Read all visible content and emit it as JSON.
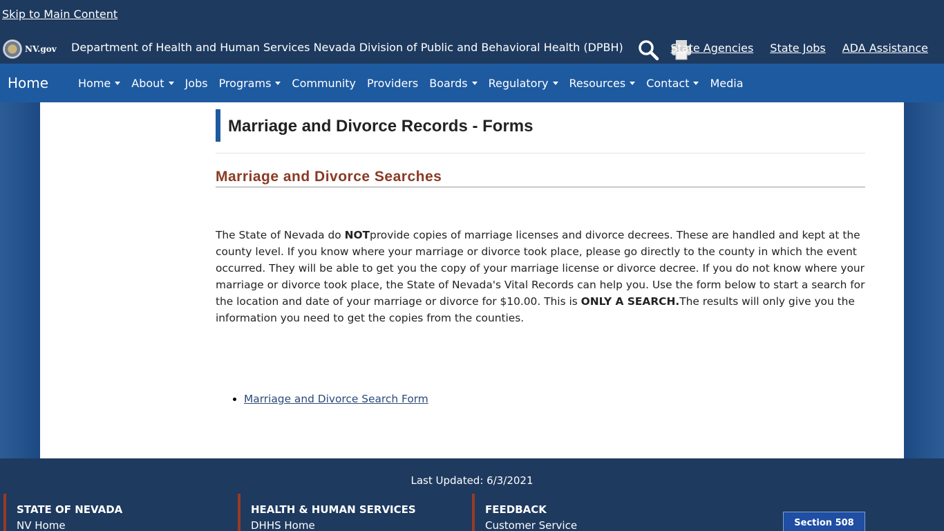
{
  "header": {
    "skip_link": "Skip to Main Content",
    "logo_text": "NV.gov",
    "agency_title": "Department of Health and Human Services Nevada Division of Public and Behavioral Health (DPBH)",
    "icons": [
      "search-icon",
      "print-icon"
    ],
    "util_links": [
      "State Agencies",
      "State Jobs",
      "ADA Assistance"
    ]
  },
  "nav": {
    "brand": "Home",
    "items": [
      {
        "label": "Home",
        "dropdown": true
      },
      {
        "label": "About",
        "dropdown": true
      },
      {
        "label": "Jobs",
        "dropdown": false
      },
      {
        "label": "Programs",
        "dropdown": true
      },
      {
        "label": "Community",
        "dropdown": false
      },
      {
        "label": "Providers",
        "dropdown": false
      },
      {
        "label": "Boards",
        "dropdown": true
      },
      {
        "label": "Regulatory",
        "dropdown": true
      },
      {
        "label": "Resources",
        "dropdown": true
      },
      {
        "label": "Contact",
        "dropdown": true
      },
      {
        "label": "Media",
        "dropdown": false
      }
    ]
  },
  "main": {
    "page_title": "Marriage and Divorce Records - Forms",
    "section_heading": "Marriage and Divorce Searches",
    "body": {
      "p1": "The State of Nevada do ",
      "b1": "NOT",
      "p2": "provide copies of marriage licenses and divorce decrees. These are handled and kept at the county level. If you know where your marriage or divorce took place, please go directly to the county in which the event occurred. They will be able to get you the copy of your marriage license or divorce decree. If you do not know where your marriage or divorce took place, the State of Nevada's Vital Records can help you. Use the form below to start a search for the location and date of your marriage or divorce for $10.00. This is ",
      "b2": "ONLY A SEARCH.",
      "p3": "The results will only give you the information you need to get the copies from the counties."
    },
    "links": [
      "Marriage and Divorce Search Form"
    ]
  },
  "footer": {
    "last_updated": "Last Updated: 6/3/2021",
    "columns": [
      {
        "title": "STATE OF NEVADA",
        "link": "NV Home"
      },
      {
        "title": "HEALTH & HUMAN SERVICES",
        "link": "DHHS Home"
      },
      {
        "title": "FEEDBACK",
        "link": "Customer Service"
      }
    ],
    "badge": "Section 508"
  },
  "colors": {
    "header_bg": "#1e3a5f",
    "nav_bg": "#1e5aa0",
    "heading_accent": "#8a3a24",
    "footer_accent": "#9b3a22"
  }
}
